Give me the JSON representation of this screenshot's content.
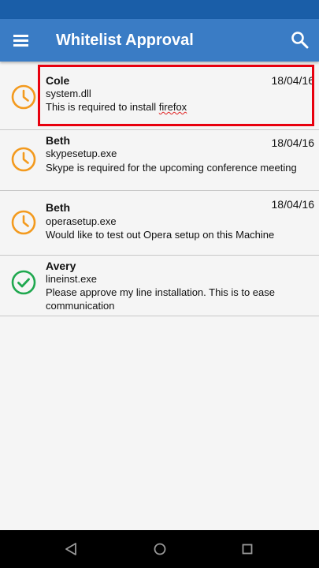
{
  "app_bar": {
    "title": "Whitelist Approval",
    "menu_icon": "hamburger-menu-icon",
    "search_icon": "search-icon"
  },
  "requests": [
    {
      "name": "Cole",
      "date": "18/04/16",
      "file": "system.dll",
      "message_prefix": "This is required to install ",
      "message_flagged": "firefox",
      "status": "pending",
      "icon": "clock-icon",
      "highlighted": true
    },
    {
      "name": "Beth",
      "date": "18/04/16",
      "file": "skypesetup.exe",
      "message": "Skype is required for the upcoming conference meeting",
      "status": "pending",
      "icon": "clock-icon"
    },
    {
      "name": "Beth",
      "date": "18/04/16",
      "file": "operasetup.exe",
      "message": "Would like to test out Opera setup on this Machine",
      "status": "pending",
      "icon": "clock-icon"
    },
    {
      "name": "Avery",
      "date": "",
      "file": "lineinst.exe",
      "message": "Please approve my line installation. This is to ease communication",
      "status": "approved",
      "icon": "check-circle-icon"
    }
  ],
  "colors": {
    "status_bar": "#1a5ea8",
    "app_bar": "#3a7cc5",
    "pending": "#f39a1e",
    "approved": "#1fa84f",
    "highlight": "#e8000e"
  },
  "nav_bar": {
    "icons": [
      "back-icon",
      "home-icon",
      "recents-icon"
    ]
  }
}
